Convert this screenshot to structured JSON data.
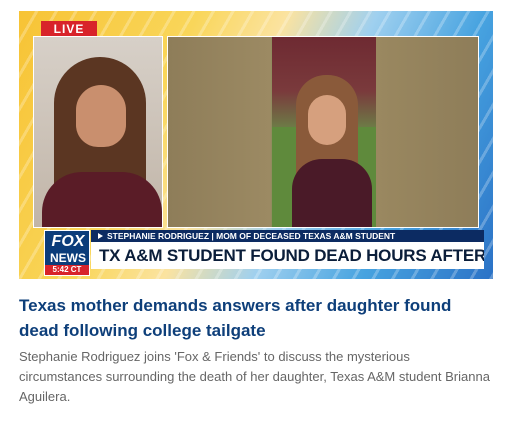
{
  "video": {
    "live_label": "LIVE",
    "network": {
      "line1": "FOX",
      "line2": "NEWS"
    },
    "time": "5:42 CT",
    "lower_third": {
      "caption": "STEPHANIE RODRIGUEZ | MOM OF DECEASED TEXAS A&M STUDENT",
      "headline": "TX A&M STUDENT FOUND DEAD HOURS AFTER TAILGATE"
    }
  },
  "article": {
    "headline": "Texas mother demands answers after daughter found dead following college tailgate",
    "description": "Stephanie Rodriguez joins 'Fox & Friends' to discuss the mysterious circumstances surrounding the death of her daughter, Texas A&M student Brianna Aguilera."
  },
  "colors": {
    "live": "#d8232a",
    "headline": "#0e3f7a",
    "banner_bar": "#0c2b62"
  }
}
